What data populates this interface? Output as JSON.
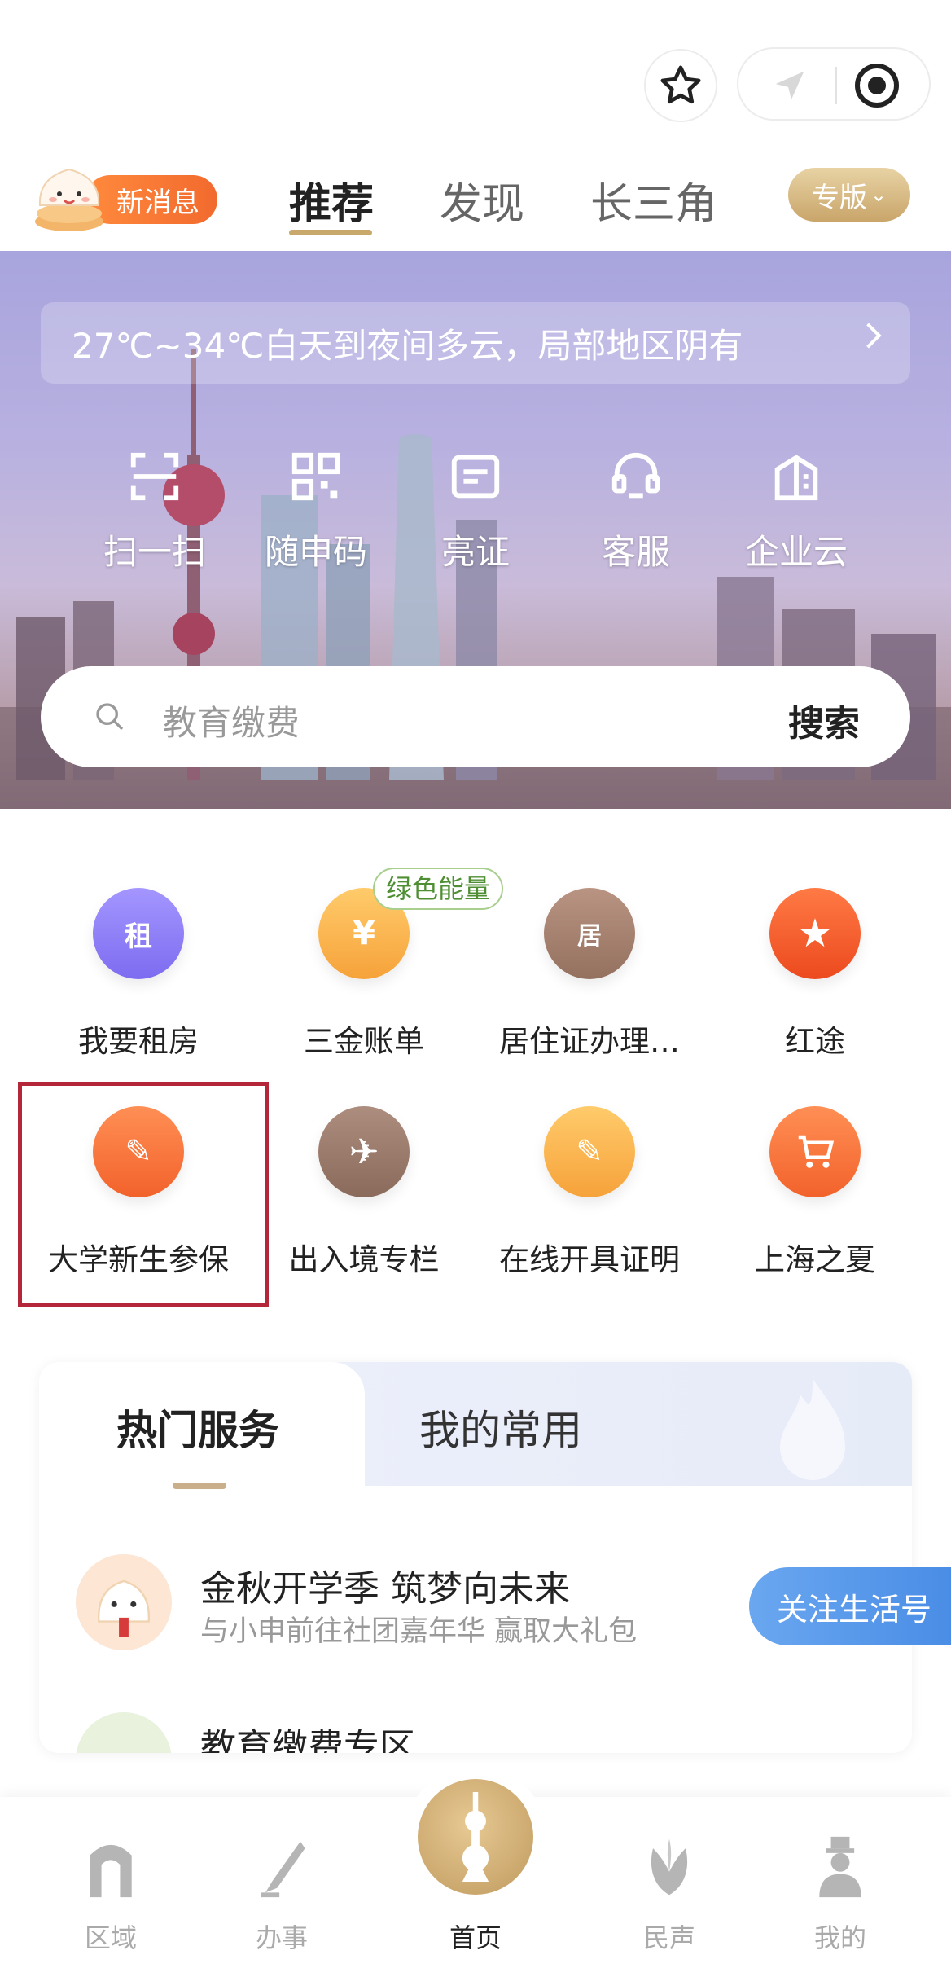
{
  "header": {
    "news_label": "新消息",
    "tabs": [
      {
        "label": "推荐",
        "active": true
      },
      {
        "label": "发现",
        "active": false
      },
      {
        "label": "长三角",
        "active": false
      }
    ],
    "edition_label": "专版",
    "edition_chevron": "⌄"
  },
  "hero": {
    "weather_text": "27℃~34℃白天到夜间多云，局部地区阴有",
    "quick_actions": [
      {
        "label": "扫一扫",
        "icon": "scan-icon"
      },
      {
        "label": "随申码",
        "icon": "qrcode-icon"
      },
      {
        "label": "亮证",
        "icon": "id-card-icon"
      },
      {
        "label": "客服",
        "icon": "headset-icon"
      },
      {
        "label": "企业云",
        "icon": "building-icon"
      }
    ],
    "search_placeholder": "教育缴费",
    "search_button": "搜索"
  },
  "services": {
    "badge": "绿色能量",
    "items": [
      {
        "label": "我要租房",
        "icon": "house-icon",
        "glyph": "租",
        "color": "#8b7cf3"
      },
      {
        "label": "三金账单",
        "icon": "yen-house-icon",
        "glyph": "¥",
        "color": "#f8b447"
      },
      {
        "label": "居住证办理…",
        "icon": "residence-card-icon",
        "glyph": "居",
        "color": "#a67c6a"
      },
      {
        "label": "红途",
        "icon": "red-star-icon",
        "glyph": "★",
        "color": "#f2552a"
      },
      {
        "label": "大学新生参保",
        "icon": "student-insurance-icon",
        "glyph": "✎",
        "color": "#f36e37"
      },
      {
        "label": "出入境专栏",
        "icon": "airplane-icon",
        "glyph": "✈",
        "color": "#9c7a6a"
      },
      {
        "label": "在线开具证明",
        "icon": "certificate-icon",
        "glyph": "✎",
        "color": "#f8b447"
      },
      {
        "label": "上海之夏",
        "icon": "shopping-cart-icon",
        "glyph": "🛒",
        "color": "#f36e37"
      }
    ]
  },
  "hot": {
    "tab_hot": "热门服务",
    "tab_common": "我的常用",
    "rows": [
      {
        "title": "金秋开学季 筑梦向未来",
        "subtitle": "与小申前往社团嘉年华 赢取大礼包"
      },
      {
        "title": "教育缴费专区",
        "subtitle": ""
      }
    ],
    "follow_button": "关注生活号"
  },
  "bottom_nav": [
    {
      "label": "区域",
      "icon": "arch-icon",
      "active": false
    },
    {
      "label": "办事",
      "icon": "pen-icon",
      "active": false
    },
    {
      "label": "首页",
      "icon": "tower-icon",
      "active": true
    },
    {
      "label": "民声",
      "icon": "flower-icon",
      "active": false
    },
    {
      "label": "我的",
      "icon": "person-icon",
      "active": false
    }
  ]
}
